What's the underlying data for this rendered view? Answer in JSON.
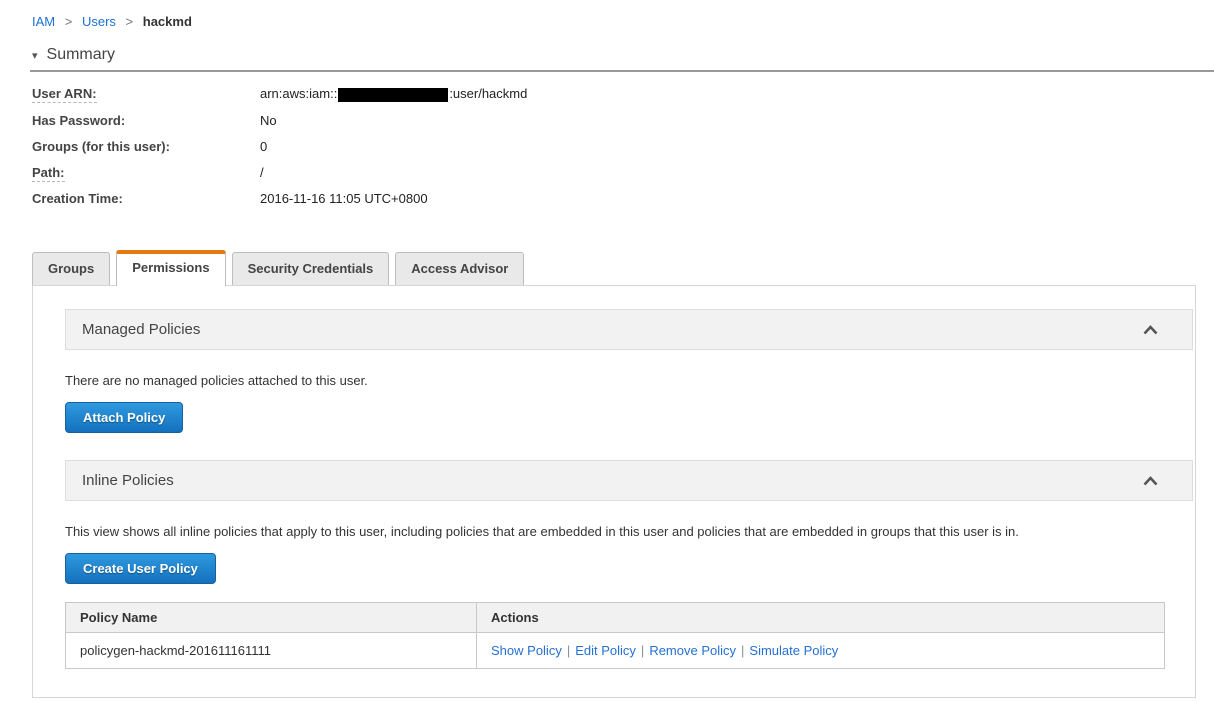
{
  "breadcrumb": {
    "separator": ">",
    "links": [
      {
        "label": "IAM"
      },
      {
        "label": "Users"
      }
    ],
    "current": "hackmd"
  },
  "summary": {
    "title": "Summary",
    "fields": {
      "user_arn": {
        "label": "User ARN:",
        "value_prefix": "arn:aws:iam::",
        "value_suffix": ":user/hackmd",
        "redacted": "account-id-redacted"
      },
      "has_password": {
        "label": "Has Password:",
        "value": "No"
      },
      "groups": {
        "label": "Groups (for this user):",
        "value": "0"
      },
      "path": {
        "label": "Path:",
        "value": "/"
      },
      "creation_time": {
        "label": "Creation Time:",
        "value": "2016-11-16 11:05 UTC+0800"
      }
    }
  },
  "tabs": {
    "items": [
      {
        "label": "Groups",
        "active": false
      },
      {
        "label": "Permissions",
        "active": true
      },
      {
        "label": "Security Credentials",
        "active": false
      },
      {
        "label": "Access Advisor",
        "active": false
      }
    ]
  },
  "managed_policies": {
    "title": "Managed Policies",
    "collapse_icon": "chevron-up",
    "empty_text": "There are no managed policies attached to this user.",
    "attach_button_label": "Attach Policy"
  },
  "inline_policies": {
    "title": "Inline Policies",
    "collapse_icon": "chevron-up",
    "description": "This view shows all inline policies that apply to this user, including policies that are embedded in this user and policies that are embedded in groups that this user is in.",
    "create_button_label": "Create User Policy",
    "table": {
      "headers": {
        "policy_name": "Policy Name",
        "actions": "Actions"
      },
      "rows": [
        {
          "policy_name": "policygen-hackmd-201611161111",
          "actions": {
            "show": "Show Policy",
            "edit": "Edit Policy",
            "remove": "Remove Policy",
            "simulate": "Simulate Policy"
          }
        }
      ]
    }
  },
  "colors": {
    "accent_orange": "#e47911",
    "link_blue": "#2470d4",
    "button_blue_top": "#2f9ae0",
    "button_blue_bottom": "#1470bd"
  }
}
